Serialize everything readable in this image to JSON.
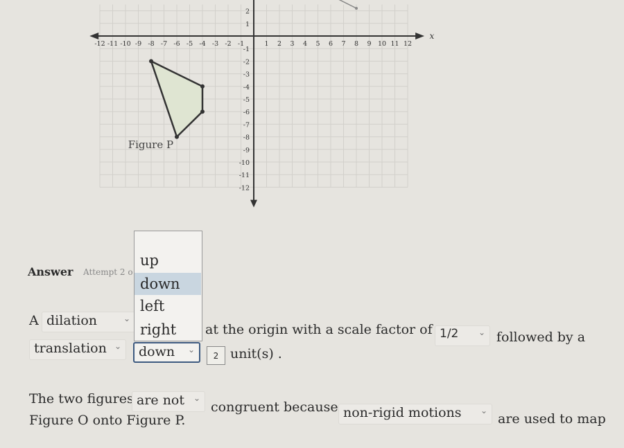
{
  "graph": {
    "x_axis_label": "x",
    "x_ticks": [
      "-12",
      "-11",
      "-10",
      "-9",
      "-8",
      "-7",
      "-6",
      "-5",
      "-4",
      "-3",
      "-2",
      "-1",
      "1",
      "2",
      "3",
      "4",
      "5",
      "6",
      "7",
      "8",
      "9",
      "10",
      "11",
      "12"
    ],
    "y_ticks_visible": [
      "2",
      "1",
      "-1",
      "-2",
      "-3",
      "-4",
      "-5",
      "-6",
      "-7",
      "-8",
      "-9",
      "-10",
      "-11",
      "-12"
    ],
    "figure_label": "Figure P",
    "figure_p_vertices": [
      [
        -8,
        -2
      ],
      [
        -4,
        -4
      ],
      [
        -4,
        -6
      ],
      [
        -6,
        -8
      ]
    ],
    "figure_fill": "#dfe5d2",
    "stroke_color": "#333333"
  },
  "answer": {
    "label": "Answer",
    "attempt": "Attempt 2 o"
  },
  "dropdown_open": {
    "options": [
      "up",
      "down",
      "left",
      "right"
    ],
    "highlighted": "down",
    "highlight_color": "#c9d6e0"
  },
  "sentence1": {
    "prefix": "A",
    "transform1": "dilation",
    "text1": "at the origin with a scale factor of",
    "scale": "1/2",
    "text2": "followed by a"
  },
  "sentence2": {
    "transform2": "translation",
    "direction": "down",
    "amount": "2",
    "text": "unit(s) ."
  },
  "sentence3": {
    "text1": "The two figures",
    "congruence": "are not",
    "text2": "congruent because",
    "reason": "non-rigid motions",
    "text3": "are used to map",
    "text4": "Figure O onto Figure P."
  },
  "chevron": "⌄"
}
